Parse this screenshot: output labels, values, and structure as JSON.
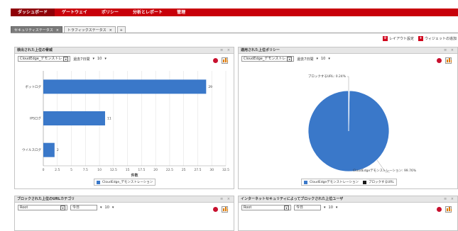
{
  "nav": {
    "items": [
      {
        "label": "ダッシュボード",
        "active": true
      },
      {
        "label": "ゲートウェイ",
        "active": false
      },
      {
        "label": "ポリシー",
        "active": false
      },
      {
        "label": "分析とレポート",
        "active": false
      },
      {
        "label": "管理",
        "active": false
      }
    ]
  },
  "tabs": [
    {
      "label": "セキュリティステータス",
      "close": "×"
    },
    {
      "label": "トラフィックステータス",
      "close": "×"
    },
    {
      "label": "+"
    }
  ],
  "toplinks": {
    "layout_label": "レイアウト設定",
    "add_widget_label": "ウィジェットの追加",
    "layout_glyph": "⚙",
    "add_glyph": "+"
  },
  "panels": {
    "threats": {
      "title": "検出された上位の脅威",
      "controls_glyph": "≡ ×",
      "device": "CloudEdge_デモンストレ",
      "period": "過去7日間",
      "count": "10",
      "dropdown_glyph": "▾",
      "xlabel": "件数",
      "legend": "CloudEdge_デモンストレーション",
      "color": "#3a78c9"
    },
    "policies": {
      "title": "適用された上位ポリシー",
      "controls_glyph": "≡ ×",
      "device": "CloudEdge_デモンストレ",
      "period": "過去7日間",
      "count": "10",
      "dropdown_glyph": "▾",
      "slice_label_big": "CloudEdgeデモンストレーション: 99.76%",
      "slice_label_small": "ブロックするURL: 0.24%",
      "legend_a": "CloudEdgeデモンストレーション",
      "legend_b": "ブロックするURL",
      "color_a": "#3a78c9",
      "color_b": "#1a1a1a"
    },
    "url_categories": {
      "title": "ブロックされた上位のURLカテゴリ",
      "controls_glyph": "≡ ×",
      "device": "Root",
      "period": "今日",
      "count": "10",
      "dropdown_glyph": "▾"
    },
    "blocked_users": {
      "title": "インターネットセキュリティによってブロックされた上位ユーザ",
      "controls_glyph": "≡ ×",
      "device": "Root",
      "period": "今日",
      "count": "10",
      "dropdown_glyph": "▾"
    }
  },
  "chart_data": [
    {
      "type": "bar",
      "orientation": "horizontal",
      "title": "検出された上位の脅威",
      "categories": [
        "ボットログ",
        "IPSログ",
        "ウイルスログ"
      ],
      "values": [
        29,
        11,
        2
      ],
      "xlabel": "件数",
      "xlim": [
        0,
        32.5
      ],
      "xticks": [
        "0",
        "2.5",
        "5",
        "7.5",
        "10",
        "12.5",
        "15",
        "17.5",
        "20",
        "22.5",
        "25",
        "27.5",
        "30",
        "32.5"
      ],
      "grid": true,
      "legend": "bottom",
      "series": [
        {
          "name": "CloudEdge_デモンストレーション",
          "values": [
            29,
            11,
            2
          ]
        }
      ]
    },
    {
      "type": "pie",
      "title": "適用された上位ポリシー",
      "categories": [
        "CloudEdgeデモンストレーション",
        "ブロックするURL"
      ],
      "values": [
        99.76,
        0.24
      ],
      "legend": "bottom"
    }
  ]
}
